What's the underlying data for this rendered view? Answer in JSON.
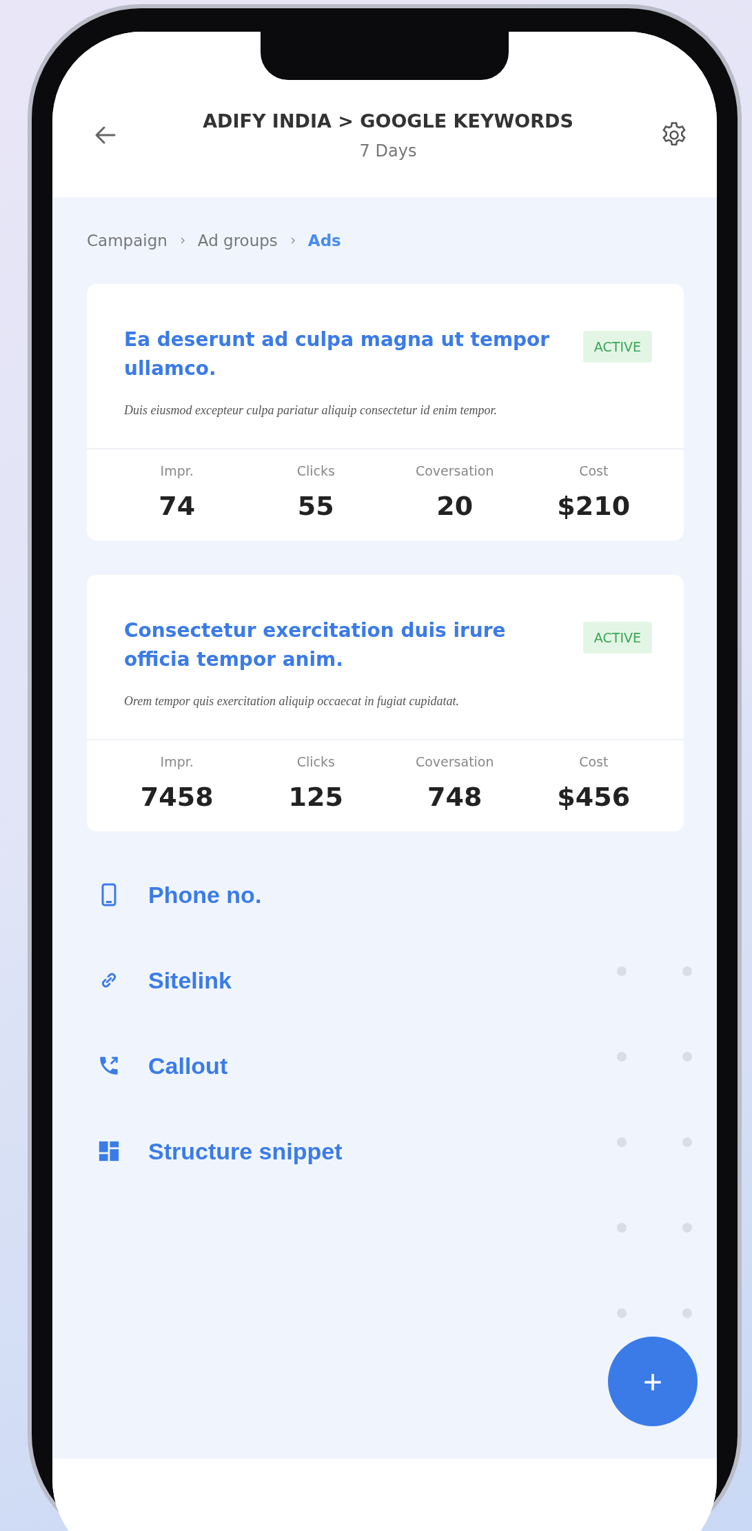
{
  "header": {
    "title": "ADIFY INDIA > GOOGLE KEYWORDS",
    "subtitle": "7 Days"
  },
  "breadcrumb": [
    {
      "label": "Campaign",
      "selected": false
    },
    {
      "label": "Ad groups",
      "selected": false
    },
    {
      "label": "Ads",
      "selected": true
    }
  ],
  "ads": [
    {
      "title": "Ea deserunt ad culpa magna ut tempor ullamco.",
      "status": "ACTIVE",
      "description": "Duis eiusmod excepteur culpa pariatur aliquip consectetur id enim tempor.",
      "stats": [
        {
          "label": "Impr.",
          "value": "74"
        },
        {
          "label": "Clicks",
          "value": "55"
        },
        {
          "label": "Coversation",
          "value": "20"
        },
        {
          "label": "Cost",
          "value": "$210"
        }
      ]
    },
    {
      "title": "Consectetur exercitation duis irure officia tempor anim.",
      "status": "ACTIVE",
      "description": "Orem tempor quis exercitation aliquip occaecat in fugiat cupidatat.",
      "stats": [
        {
          "label": "Impr.",
          "value": "7458"
        },
        {
          "label": "Clicks",
          "value": "125"
        },
        {
          "label": "Coversation",
          "value": "748"
        },
        {
          "label": "Cost",
          "value": "$456"
        }
      ]
    }
  ],
  "extensions": [
    {
      "kind": "phone",
      "label": "Phone no."
    },
    {
      "kind": "link",
      "label": "Sitelink"
    },
    {
      "kind": "call",
      "label": "Callout"
    },
    {
      "kind": "grid",
      "label": "Structure snippet"
    }
  ],
  "fab": {
    "label": "+"
  }
}
